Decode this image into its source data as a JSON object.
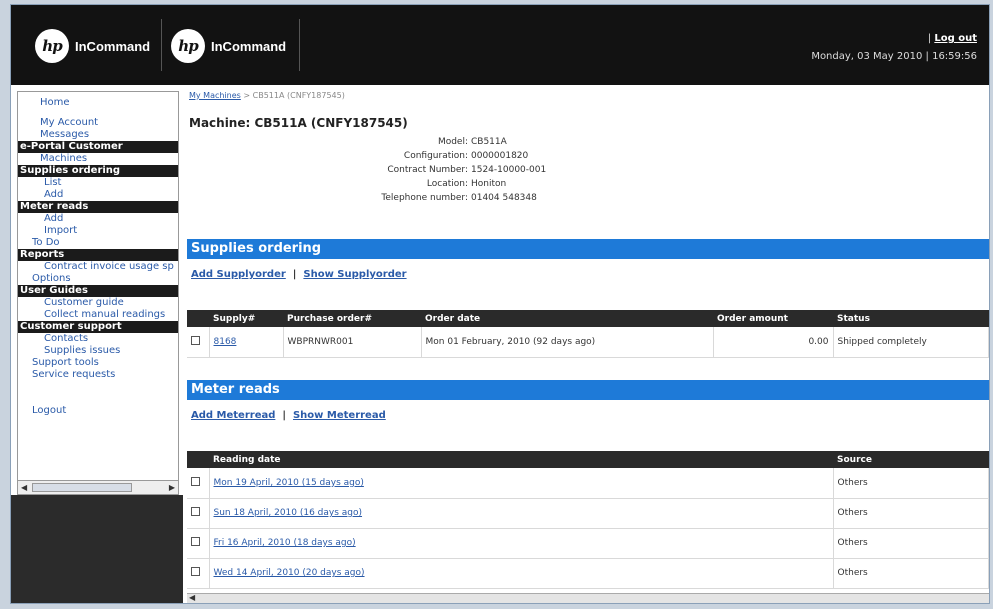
{
  "header": {
    "logo_mark": "hp",
    "brand": "InCommand",
    "logout_sep": "|",
    "logout": "Log out",
    "datetime": "Monday, 03 May 2010 | 16:59:56"
  },
  "sidebar": {
    "home": "Home",
    "my_account": "My Account",
    "messages": "Messages",
    "eportal": "e-Portal Customer",
    "machines": "Machines",
    "supplies_ordering": "Supplies ordering",
    "list": "List",
    "add": "Add",
    "meter_reads": "Meter reads",
    "meter_add": "Add",
    "meter_import": "Import",
    "todo": "To Do",
    "reports": "Reports",
    "contract_invoice": "Contract invoice usage sp",
    "options": "Options",
    "user_guides": "User Guides",
    "customer_guide": "Customer guide",
    "collect_manual": "Collect manual readings",
    "customer_support": "Customer support",
    "contacts": "Contacts",
    "supplies_issues": "Supplies issues",
    "support_tools": "Support tools",
    "service_requests": "Service requests",
    "logout": "Logout"
  },
  "breadcrumb": {
    "root": "My Machines",
    "sep": ">",
    "current": "CB511A (CNFY187545)"
  },
  "machine": {
    "title": "Machine: CB511A (CNFY187545)",
    "model_label": "Model:",
    "model": "CB511A",
    "config_label": "Configuration:",
    "config": "0000001820",
    "contract_label": "Contract Number:",
    "contract": "1524-10000-001",
    "location_label": "Location:",
    "location": "Honiton",
    "phone_label": "Telephone number:",
    "phone": "01404 548348"
  },
  "supplies": {
    "heading": "Supplies ordering",
    "add_link": "Add Supplyorder",
    "sep": "|",
    "show_link": "Show Supplyorder",
    "columns": [
      "Supply#",
      "Purchase order#",
      "Order date",
      "Order amount",
      "Status"
    ],
    "rows": [
      {
        "supply": "8168",
        "po": "WBPRNWR001",
        "date": "Mon 01 February, 2010 (92 days ago)",
        "amount": "0.00",
        "status": "Shipped completely"
      }
    ]
  },
  "meter": {
    "heading": "Meter reads",
    "add_link": "Add Meterread",
    "sep": "|",
    "show_link": "Show Meterread",
    "columns": [
      "Reading date",
      "Source"
    ],
    "rows": [
      {
        "date": "Mon 19 April, 2010 (15 days ago)",
        "source": "Others"
      },
      {
        "date": "Sun 18 April, 2010 (16 days ago)",
        "source": "Others"
      },
      {
        "date": "Fri 16 April, 2010 (18 days ago)",
        "source": "Others"
      },
      {
        "date": "Wed 14 April, 2010 (20 days ago)",
        "source": "Others"
      }
    ]
  },
  "colors": {
    "accent_blue": "#1e7ad8",
    "header_bg": "#121212",
    "link": "#2a5aa8"
  }
}
